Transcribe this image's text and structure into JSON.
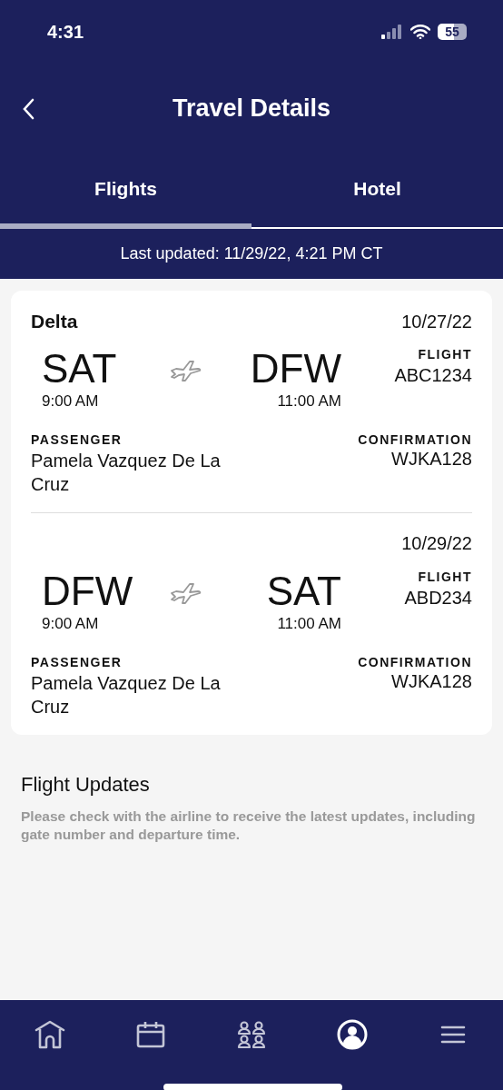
{
  "status_bar": {
    "time": "4:31",
    "battery": "55"
  },
  "header": {
    "title": "Travel Details"
  },
  "tabs": [
    {
      "label": "Flights",
      "selected": true
    },
    {
      "label": "Hotel",
      "selected": false
    }
  ],
  "last_updated": "Last updated: 11/29/22, 4:21 PM CT",
  "flights": [
    {
      "carrier": "Delta",
      "date": "10/27/22",
      "origin": "SAT",
      "origin_time": "9:00 AM",
      "destination": "DFW",
      "destination_time": "11:00 AM",
      "flight_label": "FLIGHT",
      "flight_number": "ABC1234",
      "passenger_label": "PASSENGER",
      "passenger": "Pamela Vazquez De La Cruz",
      "confirmation_label": "CONFIRMATION",
      "confirmation": "WJKA128"
    },
    {
      "date": "10/29/22",
      "origin": "DFW",
      "origin_time": "9:00 AM",
      "destination": "SAT",
      "destination_time": "11:00 AM",
      "flight_label": "FLIGHT",
      "flight_number": "ABD234",
      "passenger_label": "PASSENGER",
      "passenger": "Pamela Vazquez De La Cruz",
      "confirmation_label": "CONFIRMATION",
      "confirmation": "WJKA128"
    }
  ],
  "flight_updates": {
    "title": "Flight Updates",
    "text": "Please check with the airline to receive the latest updates, including gate number and departure time."
  },
  "bottom_nav": [
    {
      "kind": "home",
      "selected": false
    },
    {
      "kind": "calendar",
      "selected": false
    },
    {
      "kind": "group",
      "selected": false
    },
    {
      "kind": "profile",
      "selected": true
    },
    {
      "kind": "menu",
      "selected": false
    }
  ]
}
